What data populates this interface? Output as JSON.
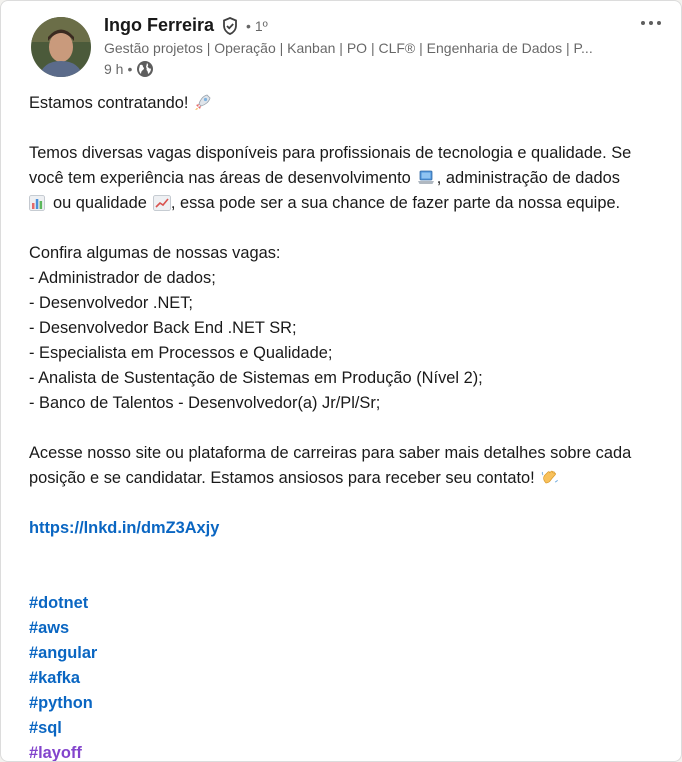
{
  "author": {
    "name": "Ingo Ferreira",
    "degree": "1º",
    "headline": "Gestão projetos | Operação | Kanban | PO | CLF® | Engenharia de Dados | P...",
    "time": "9 h",
    "separator": "•"
  },
  "icons": {
    "verified": "verified-shield-icon",
    "visibility": "globe-icon",
    "menu": "more-horizontal-icon"
  },
  "post": {
    "intro": "Estamos contratando!",
    "para1_line1": "Temos diversas vagas disponíveis para profissionais de tecnologia e qualidade. Se",
    "para1_line2a": "você tem experiência nas áreas de desenvolvimento",
    "para1_line2b": ", administração de dados",
    "para1_line3a": "ou qualidade",
    "para1_line3b": ", essa pode ser a sua chance de fazer parte da nossa equipe.",
    "list_title": "Confira algumas de nossas vagas:",
    "jobs": [
      "- Administrador de dados;",
      "- Desenvolvedor .NET;",
      "- Desenvolvedor Back End .NET SR;",
      "- Especialista em Processos e Qualidade;",
      "- Analista de Sustentação de Sistemas em Produção (Nível 2);",
      "- Banco de Talentos - Desenvolvedor(a) Jr/Pl/Sr;"
    ],
    "cta_line1": "Acesse nosso site ou plataforma de carreiras para saber mais detalhes sobre cada",
    "cta_line2": "posição e se candidatar. Estamos ansiosos para receber seu contato!",
    "link": "https://lnkd.in/dmZ3Axjy",
    "hashtags": [
      "#dotnet",
      "#aws",
      "#angular",
      "#kafka",
      "#python",
      "#sql",
      "#layoff"
    ]
  },
  "colors": {
    "link": "#0a66c2",
    "visited": "#8344cc"
  }
}
